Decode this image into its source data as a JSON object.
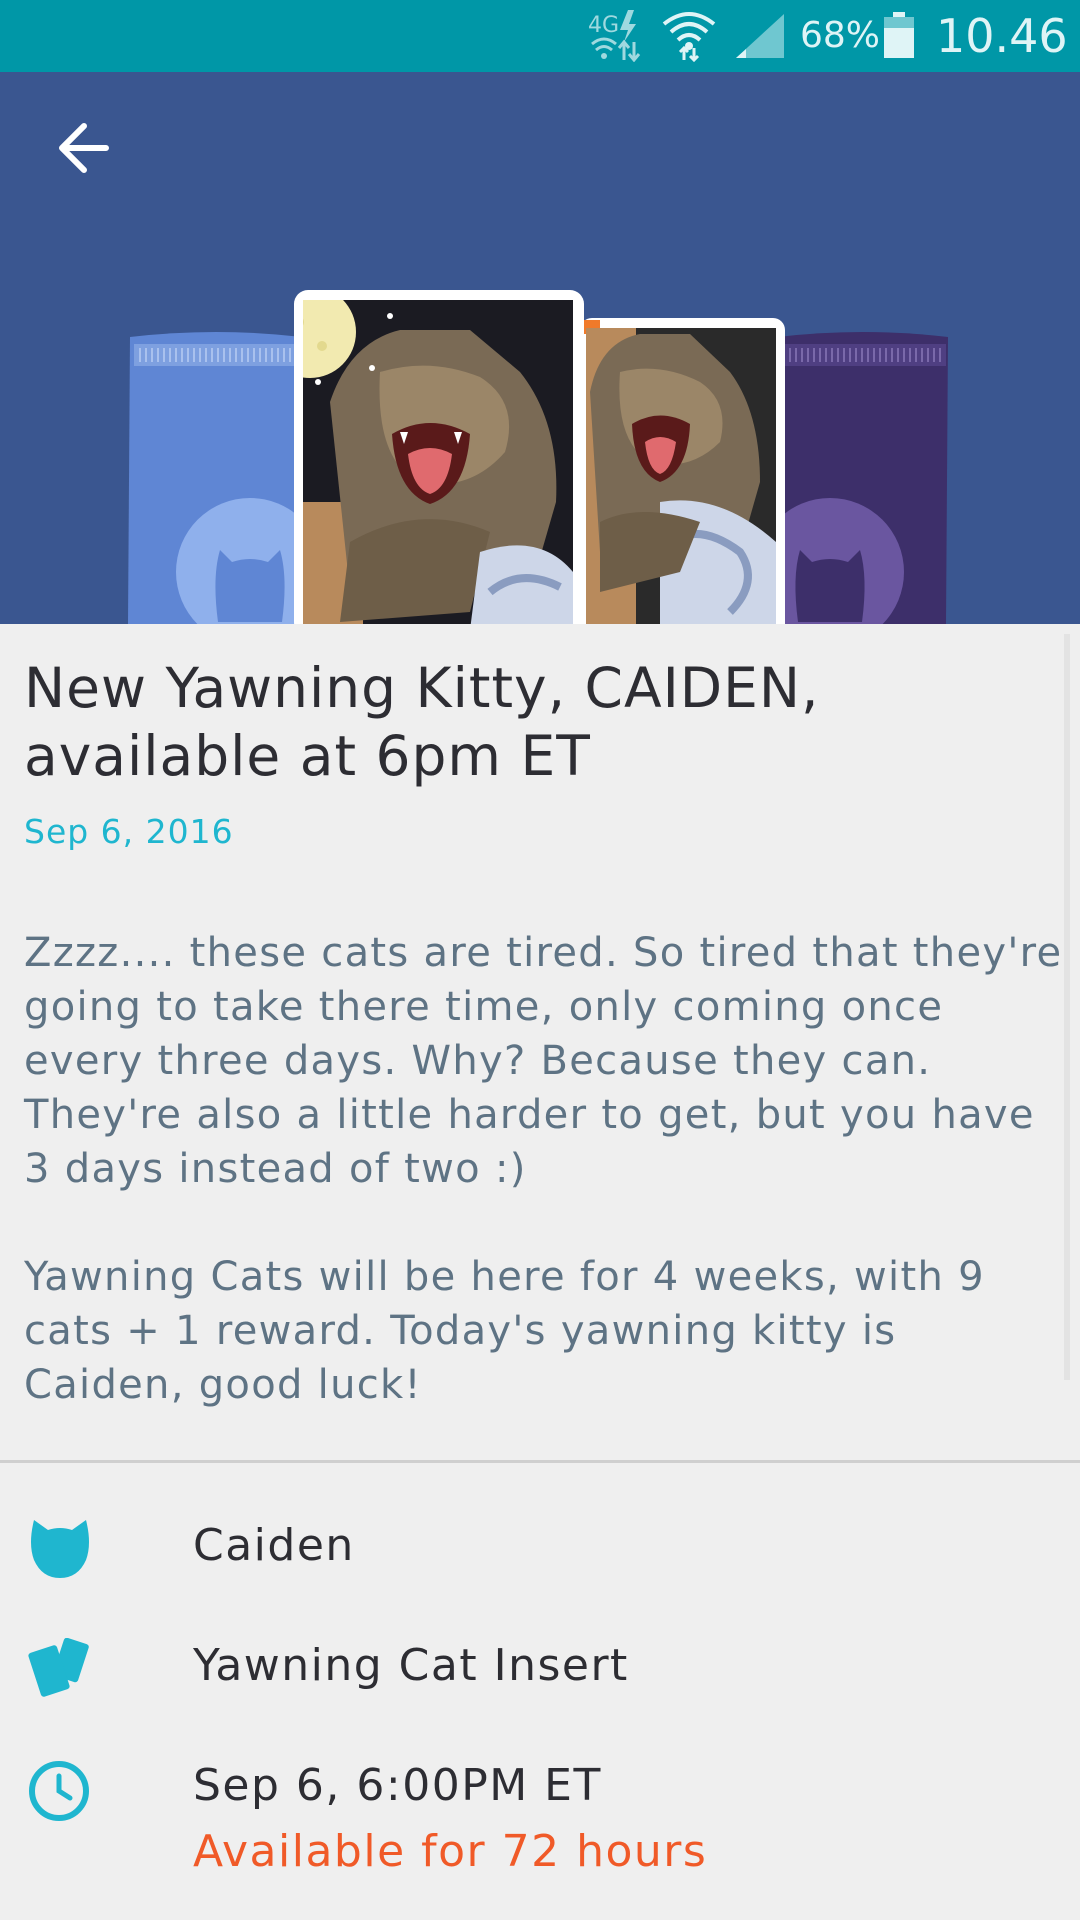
{
  "status_bar": {
    "network": "4G",
    "battery_percent": "68%",
    "time": "10.46",
    "color": "#0097a7"
  },
  "hero": {
    "background": "#3a5690",
    "back_icon": "arrow-left-icon"
  },
  "article": {
    "title": "New Yawning Kitty, CAIDEN, available at 6pm ET",
    "date": "Sep 6, 2016",
    "paragraphs": [
      "Zzzz.... these cats are tired. So tired that they're going to take there time, only coming once every three days. Why? Because they can. They're also a little harder to get, but you have 3 days instead of two :)",
      "Yawning Cats will be here for 4 weeks, with 9 cats + 1 reward. Today's yawning kitty is Caiden, good luck!"
    ]
  },
  "details": {
    "cat_name": "Caiden",
    "cat_icon": "cat-head-icon",
    "insert": "Yawning Cat Insert",
    "insert_icon": "cards-icon",
    "release_time": "Sep 6, 6:00PM ET",
    "clock_icon": "clock-icon",
    "availability": "Available for 72 hours"
  },
  "colors": {
    "accent": "#1fb6cf",
    "availability": "#f05a28",
    "body_text": "#5e7384"
  }
}
